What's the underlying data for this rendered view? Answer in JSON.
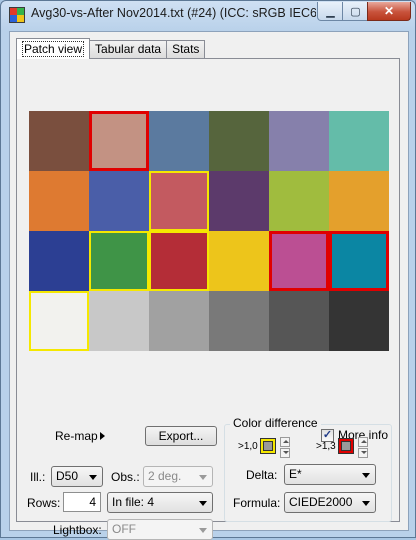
{
  "window": {
    "title": "Avg30-vs-After Nov2014.txt (#24) (ICC: sRGB IEC6...",
    "minimize_glyph": "▁",
    "maximize_glyph": "▢",
    "close_glyph": "✕"
  },
  "tabs": [
    "Patch view",
    "Tabular data",
    "Stats"
  ],
  "patches": [
    {
      "color": "#7a4f3e",
      "highlight": ""
    },
    {
      "color": "#c39283",
      "highlight": "red"
    },
    {
      "color": "#5b7a9f",
      "highlight": ""
    },
    {
      "color": "#56653d",
      "highlight": ""
    },
    {
      "color": "#8680ab",
      "highlight": ""
    },
    {
      "color": "#64bca9",
      "highlight": ""
    },
    {
      "color": "#de7a31",
      "highlight": ""
    },
    {
      "color": "#4a5ea8",
      "highlight": ""
    },
    {
      "color": "#c35a60",
      "highlight": "yellow"
    },
    {
      "color": "#5c3a6b",
      "highlight": ""
    },
    {
      "color": "#a0bc3e",
      "highlight": ""
    },
    {
      "color": "#e4a02c",
      "highlight": ""
    },
    {
      "color": "#2c3f93",
      "highlight": ""
    },
    {
      "color": "#3f9447",
      "highlight": "yellow"
    },
    {
      "color": "#b42d37",
      "highlight": "yellow"
    },
    {
      "color": "#edc51b",
      "highlight": ""
    },
    {
      "color": "#bb4f93",
      "highlight": "red"
    },
    {
      "color": "#0b86a3",
      "highlight": "red"
    },
    {
      "color": "#f2f2ee",
      "highlight": "yellow"
    },
    {
      "color": "#c8c8c8",
      "highlight": ""
    },
    {
      "color": "#a1a1a1",
      "highlight": ""
    },
    {
      "color": "#797979",
      "highlight": ""
    },
    {
      "color": "#565656",
      "highlight": ""
    },
    {
      "color": "#343434",
      "highlight": ""
    }
  ],
  "controls": {
    "remap_label": "Re-map",
    "export_label": "Export...",
    "more_info_label": "More info",
    "more_info_checked": true,
    "ill_label": "Ill.:",
    "ill_value": "D50",
    "obs_label": "Obs.:",
    "obs_value": "2 deg.",
    "rows_label": "Rows:",
    "rows_value": "4",
    "infile_value": "In file: 4",
    "lightbox_label": "Lightbox:",
    "lightbox_value": "OFF"
  },
  "color_difference": {
    "title": "Color difference",
    "threshold1_label": ">1,0",
    "threshold1_color": "#f5e800",
    "threshold2_label": ">1,3",
    "threshold2_color": "#e00000",
    "delta_label": "Delta:",
    "delta_value": "E*",
    "formula_label": "Formula:",
    "formula_value": "CIEDE2000"
  }
}
